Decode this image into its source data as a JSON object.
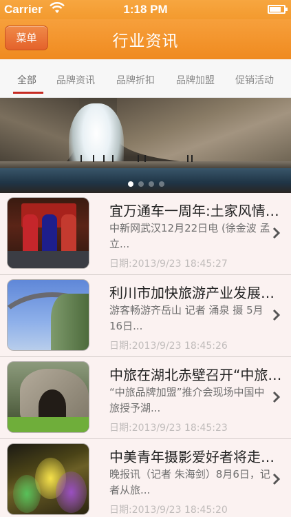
{
  "status_bar": {
    "carrier": "Carrier",
    "time": "1:18 PM",
    "battery_level": 0.8
  },
  "nav": {
    "menu_label": "菜单",
    "title": "行业资讯"
  },
  "tabs": [
    {
      "label": "全部",
      "active": true
    },
    {
      "label": "品牌资讯",
      "active": false
    },
    {
      "label": "品牌折扣",
      "active": false
    },
    {
      "label": "品牌加盟",
      "active": false
    },
    {
      "label": "促销活动",
      "active": false
    }
  ],
  "banner": {
    "page_count": 4,
    "current_page": 1
  },
  "news": [
    {
      "title": "宜万通车一周年:土家风情旅游发展",
      "summary": "中新网武汉12月22日电 (徐金波 孟立...",
      "date": "日期:2013/9/23 18:45:27"
    },
    {
      "title": "利川市加快旅游产业发展步伐",
      "summary": "游客畅游齐岳山 记者 涌泉 摄 5月16日...",
      "date": "日期:2013/9/23 18:45:26"
    },
    {
      "title": "中旅在湖北赤壁召开“中旅品牌加盟”",
      "summary": "“中旅品牌加盟”推介会现场中国中旅授予湖...",
      "date": "日期:2013/9/23 18:45:23"
    },
    {
      "title": "中美青年摄影爱好者将走进腾龙洞",
      "summary": "晚报讯（记者 朱海剑）8月6日，记者从旅...",
      "date": "日期:2013/9/23 18:45:20"
    }
  ],
  "colors": {
    "nav_orange": "#ef8a1f",
    "tab_indicator": "#c62b23",
    "list_bg": "#fbf2f1"
  }
}
